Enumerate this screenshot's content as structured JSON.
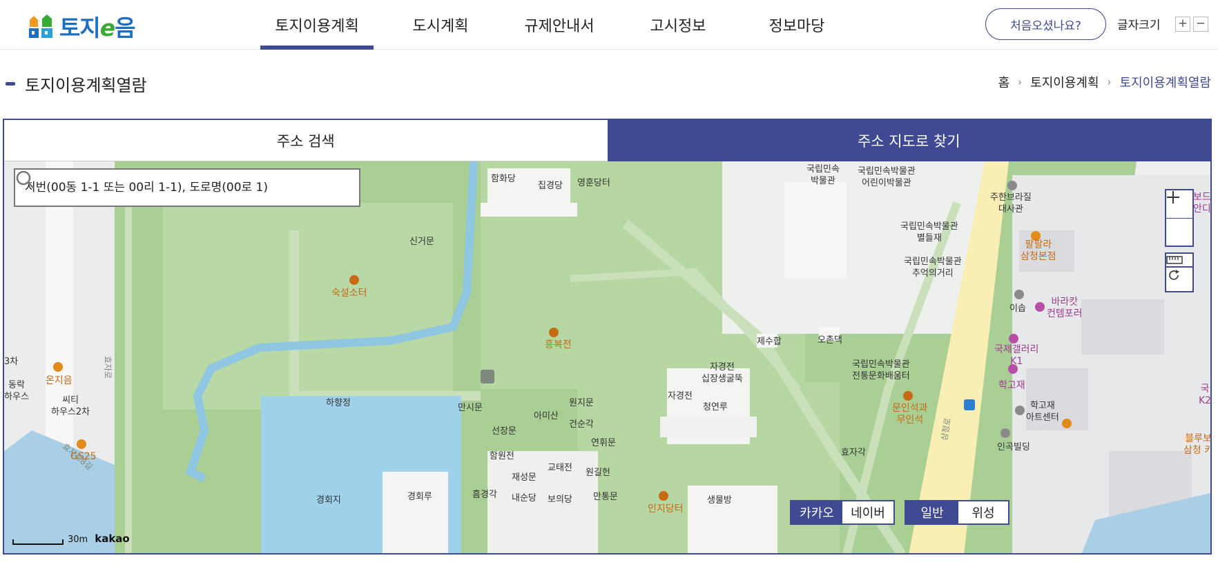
{
  "header": {
    "logo_text_a": "토지",
    "logo_text_e": "e",
    "logo_text_b": "음",
    "nav": [
      {
        "label": "토지이용계획",
        "active": true
      },
      {
        "label": "도시계획",
        "active": false
      },
      {
        "label": "규제안내서",
        "active": false
      },
      {
        "label": "고시정보",
        "active": false
      },
      {
        "label": "정보마당",
        "active": false
      }
    ],
    "first_visit_button": "처음오셨나요?",
    "font_size_label": "글자크기",
    "font_plus": "+",
    "font_minus": "−"
  },
  "page": {
    "title": "토지이용계획열람",
    "breadcrumb": [
      "홈",
      "토지이용계획",
      "토지이용계획열람"
    ]
  },
  "tabs": {
    "address_search": "주소 검색",
    "map_search": "주소 지도로 찾기"
  },
  "search": {
    "placeholder": "지번(00동 1-1 또는 00리 1-1), 도로명(00로 1)"
  },
  "map": {
    "provider_toggle": {
      "kakao": "카카오",
      "naver": "네이버"
    },
    "type_toggle": {
      "normal": "일반",
      "satellite": "위성"
    },
    "scale_label": "30m",
    "attribution": "kakao",
    "labels": {
      "hamhwadang": "함화당",
      "jipgyeongdang": "집경당",
      "yeonghundang": "영훈당터",
      "sindeokmun": "신거문",
      "sukseol": "숙설소터",
      "heungbokjeon": "흥복전",
      "hahyangjeong": "하향정",
      "mansimun": "만시문",
      "amisan": "아미산",
      "wonjimun": "원지문",
      "geonsungak": "건순각",
      "seonjangmun": "선장문",
      "hamwonjeon": "함원전",
      "gyotaejeon": "교태전",
      "yeonhwimun": "연휘문",
      "jaeseongmun": "재성문",
      "wongilheon": "원길헌",
      "heumgyeonggak": "흠경각",
      "naesundang": "내순당",
      "boeuidang": "보의당",
      "mantongmun": "만통문",
      "injidang": "인지당터",
      "saengmulbang": "생물방",
      "gyeonghoeji": "경회지",
      "gyeonghoeru": "경회루",
      "museum_a": "국립민속",
      "museum_b": "박물관",
      "kids_museum_a": "국립민속박물관",
      "kids_museum_b": "어린이박물관",
      "byeoldeuljae_a": "국립민속박물관",
      "byeoldeuljae_b": "별들재",
      "memory_a": "국립민속박물관",
      "memory_b": "추억의거리",
      "jesuhap": "제수합",
      "ochondaek": "오촌댁",
      "jagyeongjeon_chimney_a": "자경전",
      "jagyeongjeon_chimney_b": "십장생굴뚝",
      "jagyeongjeon": "자경전",
      "cheongyeonru": "청연루",
      "traditional_a": "국립민속박물관",
      "traditional_b": "전통문화배움터",
      "munin_a": "문인석과",
      "munin_b": "무인석",
      "hyojagak": "효자각",
      "embassy_a": "주한브라질",
      "embassy_b": "대사관",
      "bodeu_a": "보드",
      "bodeu_b": "안디",
      "palpal_a": "팔팔라",
      "palpal_b": "삼청본점",
      "iseup": "이솝",
      "baracat_a": "바라캇",
      "baracat_b": "컨템포러",
      "kukje_a": "국제갤러리",
      "kukje_b": "K1",
      "hakgojae": "학고재",
      "kuk_k2_a": "국",
      "kuk_k2_b": "K2",
      "hakgojae_art_a": "학고재",
      "hakgojae_art_b": "아트센터",
      "ingok": "인곡빌딩",
      "blue_a": "블루보",
      "blue_b": "삼청 카",
      "onjieum": "온지음",
      "city_a": "씨티",
      "city_b": "하우스2차",
      "gs25": "GS25",
      "left_3cha": "3차",
      "left_dongnak_a": "동락",
      "left_dongnak_b": "하우스",
      "road_hyoja": "효자로",
      "road_hyoja8": "효자로8길",
      "road_top_right": "삼청로"
    }
  }
}
